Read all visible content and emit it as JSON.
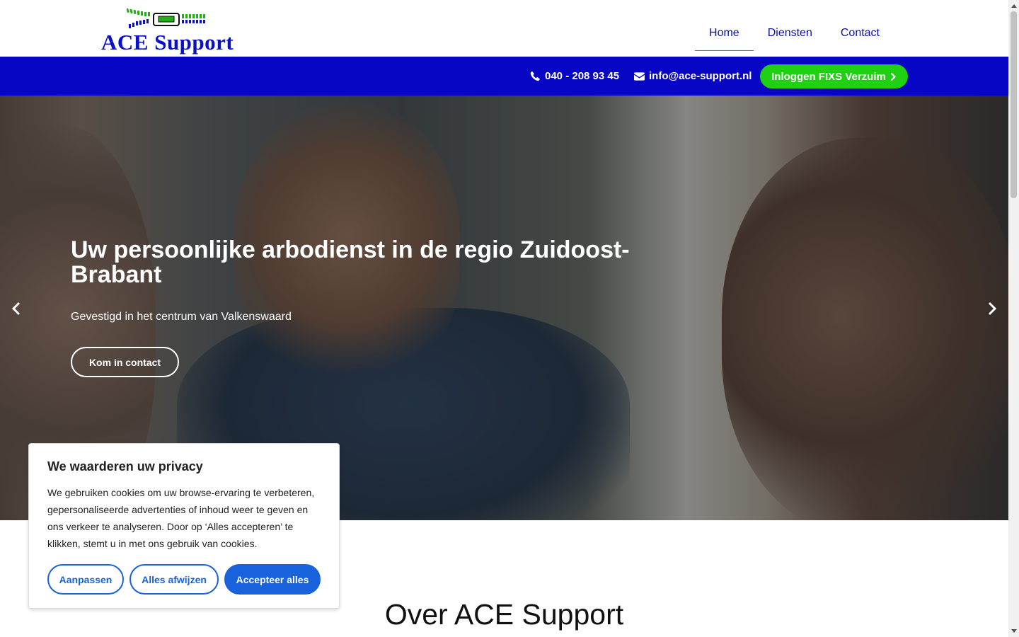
{
  "header": {
    "logo_text": "ACE Support",
    "nav": [
      {
        "label": "Home",
        "active": true
      },
      {
        "label": "Diensten",
        "active": false
      },
      {
        "label": "Contact",
        "active": false
      }
    ]
  },
  "topbar": {
    "phone": "040 - 208 93 45",
    "email": "info@ace-support.nl",
    "login_label": "Inloggen FIXS Verzuim",
    "background": "#0606c4",
    "login_color": "#20d012"
  },
  "hero": {
    "title": "Uw persoonlijke arbodienst in de regio Zuidoost-Brabant",
    "subtitle": "Gevestigd in het centrum van Valkenswaard",
    "cta_label": "Kom in contact"
  },
  "about": {
    "title": "Over ACE Support"
  },
  "cookie_banner": {
    "title": "We waarderen uw privacy",
    "text": "We gebruiken cookies om uw browse-ervaring te verbeteren, gepersonaliseerde advertenties of inhoud weer te geven en ons verkeer te analyseren. Door op ‘Alles accepteren’ te klikken, stemt u in met ons gebruik van cookies.",
    "customize_label": "Aanpassen",
    "reject_label": "Alles afwijzen",
    "accept_label": "Accepteer alles",
    "accent": "#1863dc"
  }
}
